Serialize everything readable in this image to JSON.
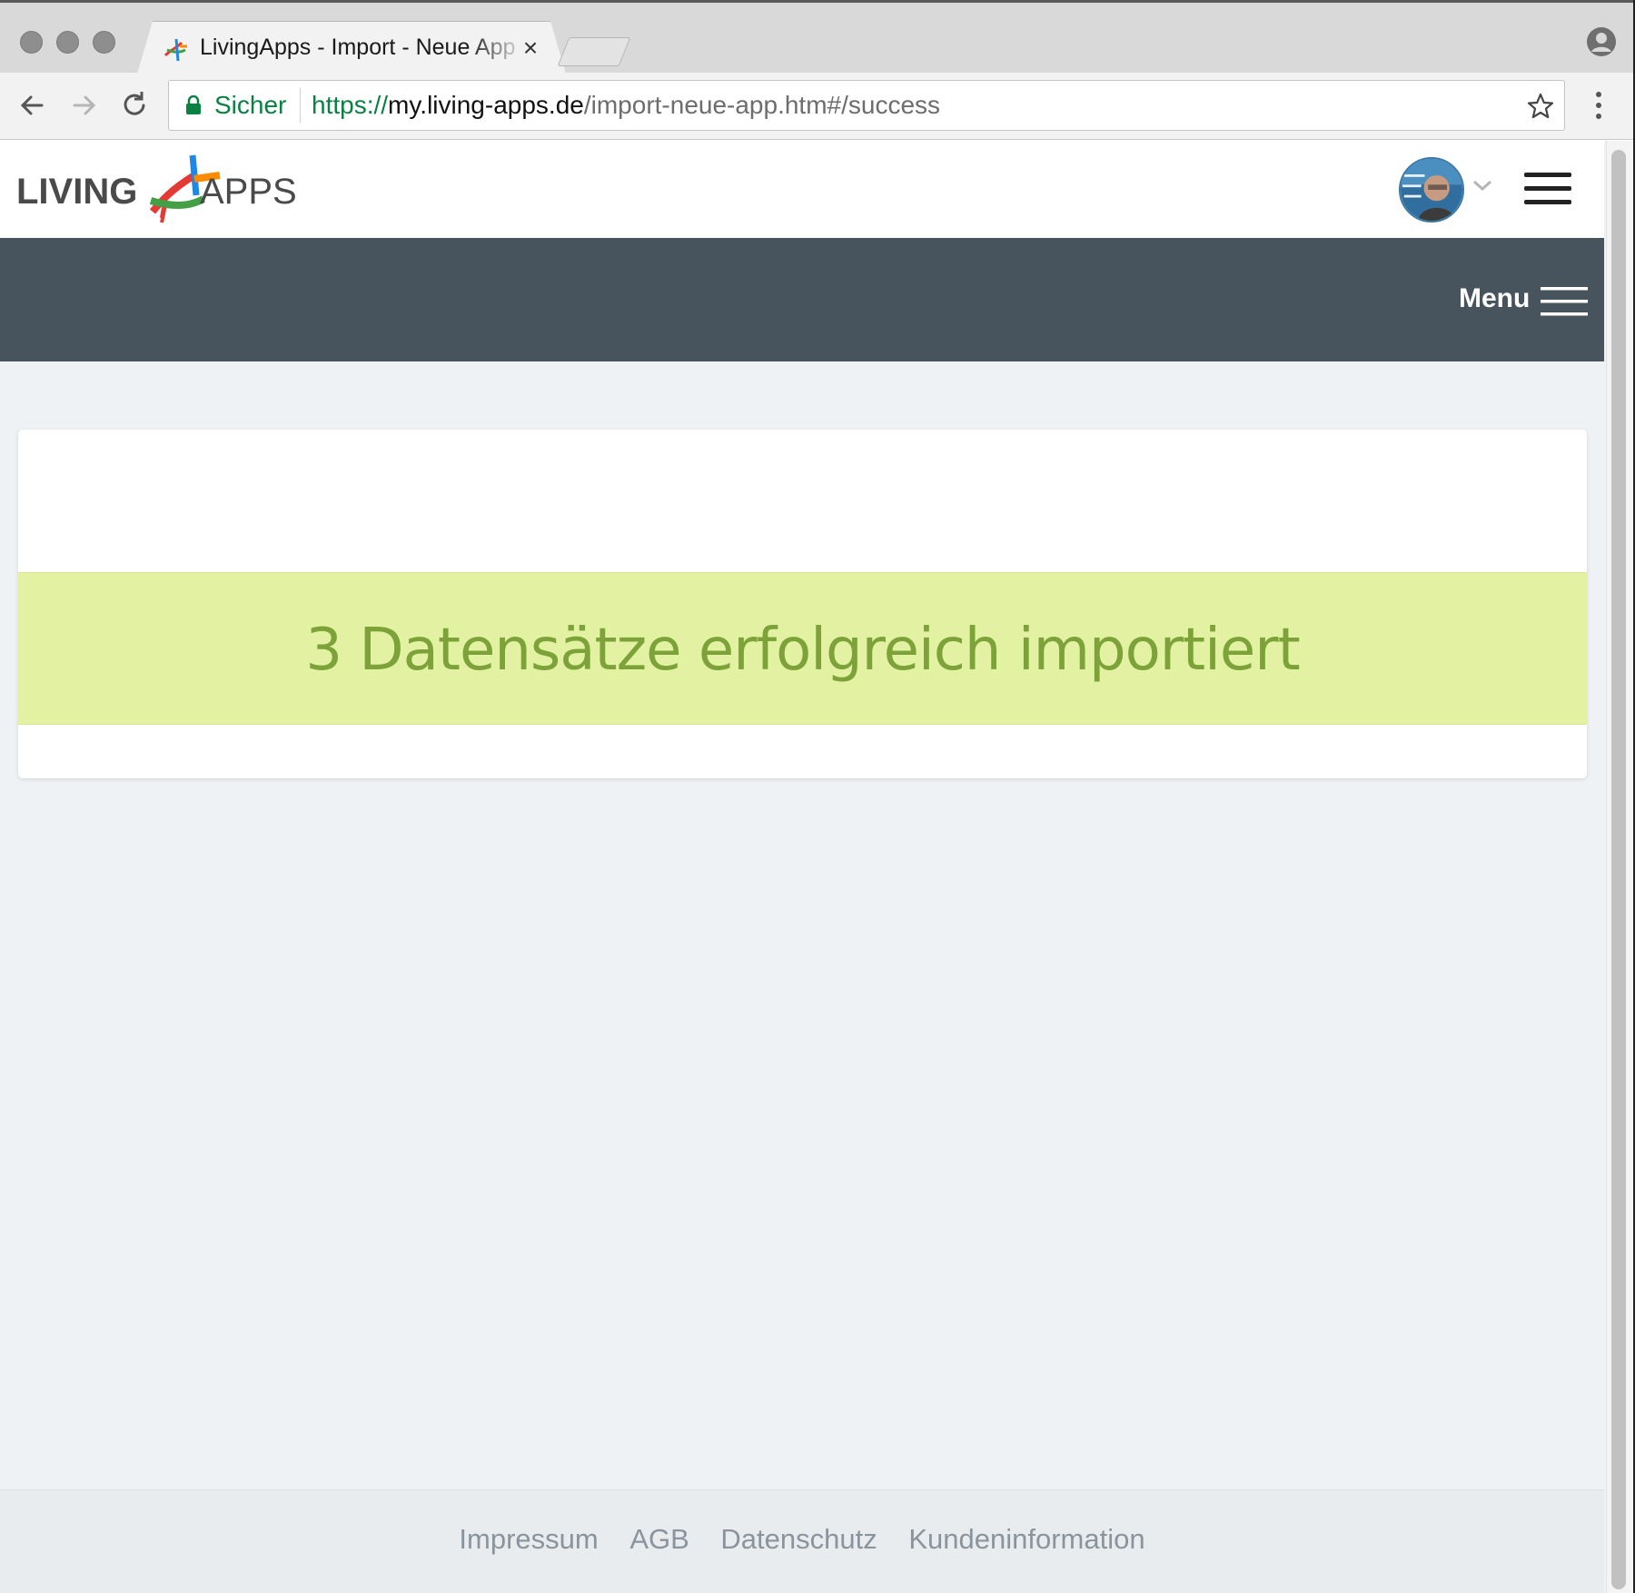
{
  "browser": {
    "tab": {
      "title": "LivingApps - Import - Neue App"
    },
    "omnibox": {
      "security_label": "Sicher",
      "url_scheme": "https://",
      "url_host": "my.living-apps.de",
      "url_path": "/import-neue-app.htm#/success"
    }
  },
  "header": {
    "logo": {
      "text_left": "LIVING",
      "text_right": "APPS"
    }
  },
  "menubar": {
    "menu_label": "Menu"
  },
  "main": {
    "success_message": "3 Datensätze erfolgreich importiert"
  },
  "footer": {
    "links": [
      "Impressum",
      "AGB",
      "Datenschutz",
      "Kundeninformation"
    ]
  },
  "colors": {
    "menubar_bg": "#48545d",
    "success_bg": "#e2f1a2",
    "success_text": "#7da23a",
    "page_bg": "#eef2f5",
    "secure_green": "#0b8043"
  }
}
